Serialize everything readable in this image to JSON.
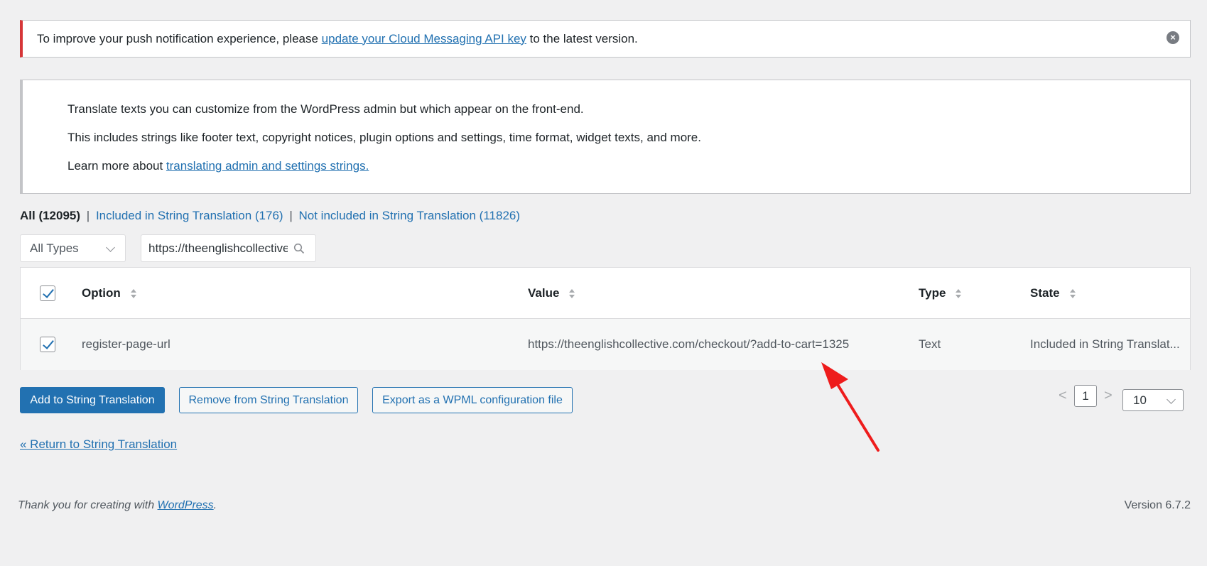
{
  "notice": {
    "text_before": "To improve your push notification experience, please ",
    "link": "update your Cloud Messaging API key",
    "text_after": " to the latest version."
  },
  "info": {
    "line1": "Translate texts you can customize from the WordPress admin but which appear on the front-end.",
    "line2": "This includes strings like footer text, copyright notices, plugin options and settings, time format, widget texts, and more.",
    "line3_prefix": "Learn more about ",
    "line3_link": "translating admin and settings strings."
  },
  "views": {
    "all": "All (12095)",
    "included": "Included in String Translation (176)",
    "not_included": "Not included in String Translation (11826)",
    "separator": "|"
  },
  "filters": {
    "type_select": "All Types",
    "search_value": "https://theenglishcollective.com"
  },
  "table": {
    "headers": {
      "option": "Option",
      "value": "Value",
      "type": "Type",
      "state": "State"
    },
    "rows": [
      {
        "option": "register-page-url",
        "value": "https://theenglishcollective.com/checkout/?add-to-cart=1325",
        "type": "Text",
        "state": "Included in String Translat..."
      }
    ]
  },
  "buttons": {
    "add": "Add to String Translation",
    "remove": "Remove from String Translation",
    "export": "Export as a WPML configuration file"
  },
  "pagination": {
    "prev": "<",
    "current": "1",
    "next": ">",
    "per_page": "10"
  },
  "return_link": "« Return to String Translation",
  "footer": {
    "thank_prefix": "Thank you for creating with ",
    "thank_link": "WordPress",
    "thank_suffix": ".",
    "version": "Version 6.7.2"
  },
  "colors": {
    "accent": "#2271b1",
    "notice_error": "#d63638",
    "annotation_arrow": "#ee1c1c"
  }
}
